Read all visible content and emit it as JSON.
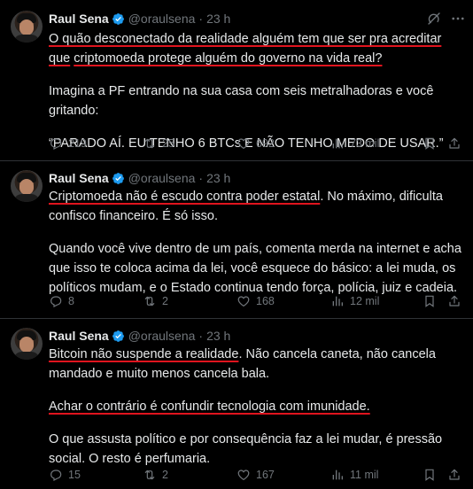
{
  "tweets": [
    {
      "author": "Raul Sena",
      "handle": "@oraulsena",
      "time": "23 h",
      "para1_a": "O quão desconectado da realidade alguém tem que ser pra acreditar que",
      "para1_b": "criptomoeda protege alguém do governo na vida real?",
      "para2": "Imagina a PF entrando na sua casa com seis metralhadoras e você gritando:",
      "para3": "“PARADO AÍ. EU TENHO 6 BTCs E NÃO TENHO MEDO DE USAR.”",
      "replies": "219",
      "reposts": "25",
      "likes": "692",
      "views": "73 mil"
    },
    {
      "author": "Raul Sena",
      "handle": "@oraulsena",
      "time": "23 h",
      "para1_hl": "Criptomoeda não é escudo contra poder estatal",
      "para1_rest": ". No máximo, dificulta confisco financeiro. É só isso.",
      "para2": "Quando você vive dentro de um país, comenta merda na internet e acha que isso te coloca acima da lei, você esquece do básico: a lei muda, os políticos mudam, e o Estado continua tendo força, polícia, juiz e cadeia.",
      "replies": "8",
      "reposts": "2",
      "likes": "168",
      "views": "12 mil"
    },
    {
      "author": "Raul Sena",
      "handle": "@oraulsena",
      "time": "23 h",
      "para1_hl": "Bitcoin não suspende a realidade",
      "para1_rest": ". Não cancela caneta, não cancela mandado e muito menos cancela bala.",
      "para2_hl": "Achar o contrário é confundir tecnologia com imunidade.",
      "para3": "O que assusta político e por consequência faz a lei mudar, é pressão social. O resto é perfumaria.",
      "replies": "15",
      "reposts": "2",
      "likes": "167",
      "views": "11 mil"
    }
  ],
  "colors": {
    "background": "#000000",
    "text": "#e7e9ea",
    "muted": "#71767b",
    "verified": "#1d9bf0",
    "highlight": "#e0141e"
  }
}
